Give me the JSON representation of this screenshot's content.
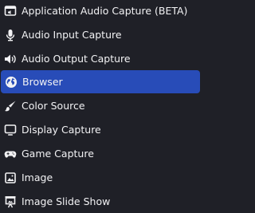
{
  "menu": {
    "items": [
      {
        "label": "Application Audio Capture (BETA)",
        "icon": "window-audio-icon"
      },
      {
        "label": "Audio Input Capture",
        "icon": "microphone-icon"
      },
      {
        "label": "Audio Output Capture",
        "icon": "speaker-icon"
      },
      {
        "label": "Browser",
        "icon": "globe-icon",
        "selected": true
      },
      {
        "label": "Color Source",
        "icon": "paintbrush-icon"
      },
      {
        "label": "Display Capture",
        "icon": "monitor-icon"
      },
      {
        "label": "Game Capture",
        "icon": "gamepad-icon"
      },
      {
        "label": "Image",
        "icon": "image-icon"
      },
      {
        "label": "Image Slide Show",
        "icon": "slideshow-icon"
      }
    ]
  },
  "colors": {
    "background": "#1f2027",
    "text": "#f2f2f4",
    "selected_background": "#284cb8"
  }
}
